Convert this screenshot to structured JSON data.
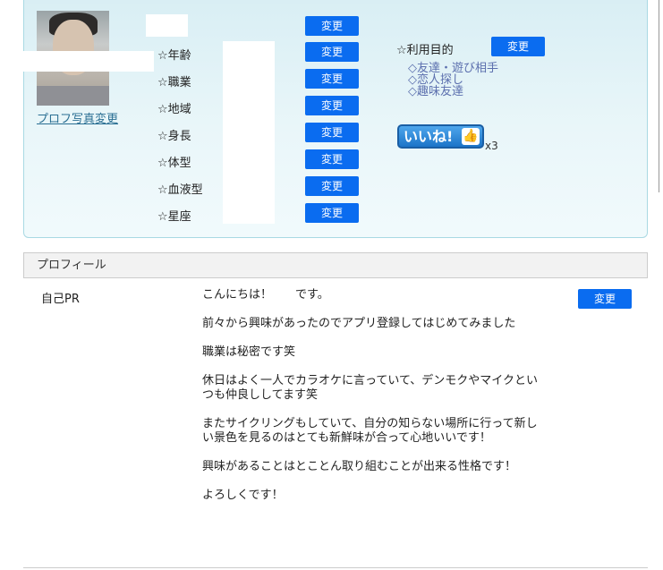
{
  "profile": {
    "photo_change_link": "プロフ写真変更",
    "attributes": [
      {
        "label": "☆年齢",
        "button": "変更"
      },
      {
        "label": "☆職業",
        "button": "変更"
      },
      {
        "label": "☆地域",
        "button": "変更"
      },
      {
        "label": "☆身長",
        "button": "変更"
      },
      {
        "label": "☆体型",
        "button": "変更"
      },
      {
        "label": "☆血液型",
        "button": "変更"
      },
      {
        "label": "☆星座",
        "button": "変更"
      }
    ],
    "name_button": "変更",
    "purpose": {
      "label": "☆利用目的",
      "button": "変更",
      "items": [
        "◇友達・遊び相手",
        "◇恋人探し",
        "◇趣味友達"
      ]
    },
    "like": {
      "label": "いいね!",
      "count": "x3"
    }
  },
  "section": {
    "title": "プロフィール",
    "pr_label": "自己PR",
    "pr_button": "変更",
    "pr_paragraphs": [
      "こんにちは！　　です。",
      "前々から興味があったのでアプリ登録してはじめてみました",
      "職業は秘密です笑",
      "休日はよく一人でカラオケに言っていて、デンモクやマイクといつも仲良ししてます笑",
      "またサイクリングもしていて、自分の知らない場所に行って新しい景色を見るのはとても新鮮味が合って心地いいです！",
      "興味があることはとことん取り組むことが出来る性格です！",
      "よろしくです！"
    ]
  }
}
